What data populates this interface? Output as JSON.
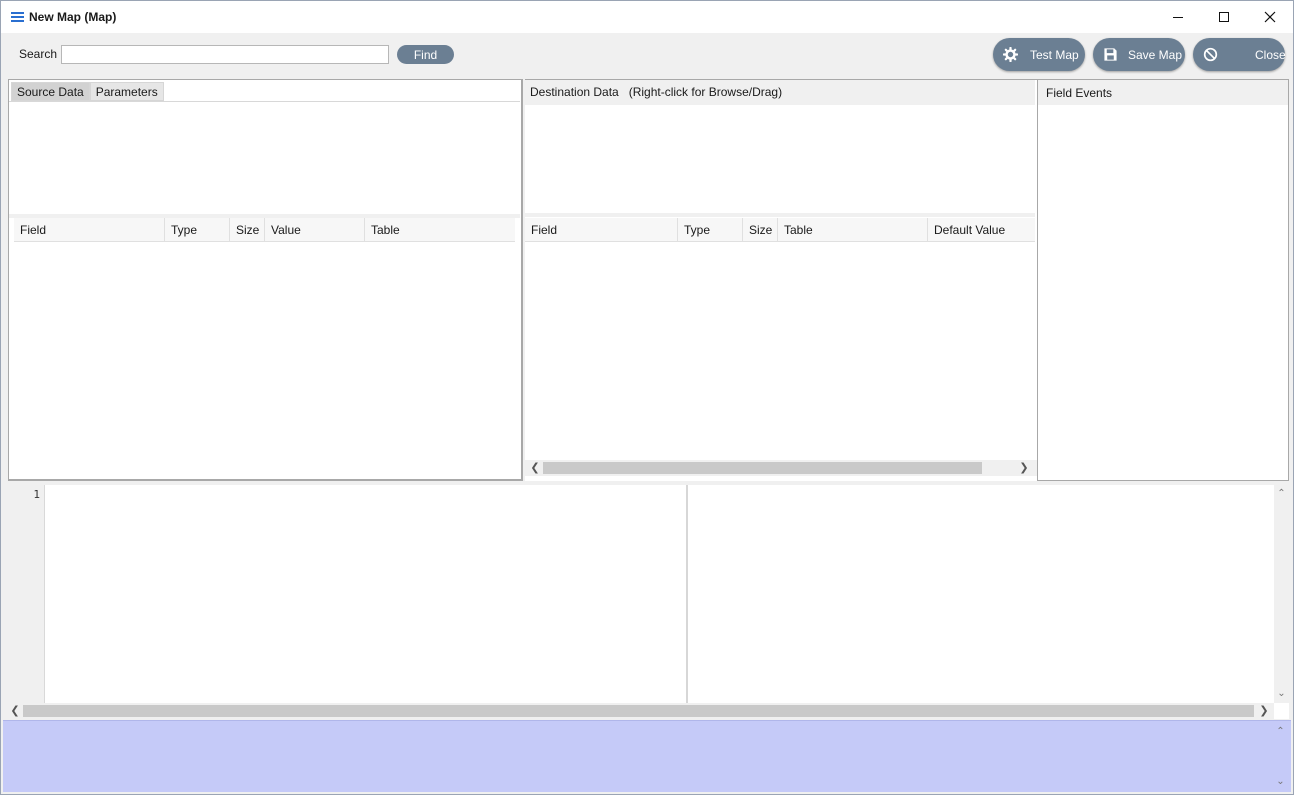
{
  "window": {
    "title": "New Map (Map)",
    "controls": [
      "minimize",
      "maximize",
      "close"
    ]
  },
  "toolbar": {
    "search_label": "Search",
    "search_value": "",
    "find_label": "Find",
    "buttons": [
      {
        "label": "Test Map",
        "icon": "gear-icon"
      },
      {
        "label": "Save Map",
        "icon": "save-icon"
      },
      {
        "label": "Close",
        "icon": "cancel-icon"
      }
    ]
  },
  "source": {
    "tabs": [
      "Source Data",
      "Parameters"
    ],
    "active_tab": "Source Data",
    "columns": [
      "Field",
      "Type",
      "Size",
      "Value",
      "Table"
    ]
  },
  "destination": {
    "header": "Destination Data   (Right-click for Browse/Drag)",
    "columns": [
      "Field",
      "Type",
      "Size",
      "Table",
      "Default Value"
    ]
  },
  "field_events": {
    "title": "Field Events"
  },
  "editor": {
    "line_numbers": [
      "1"
    ]
  },
  "colors": {
    "button_bg": "#6b7f93",
    "output_bg": "#c5caf8",
    "accent_icon": "#2a6fd0"
  }
}
